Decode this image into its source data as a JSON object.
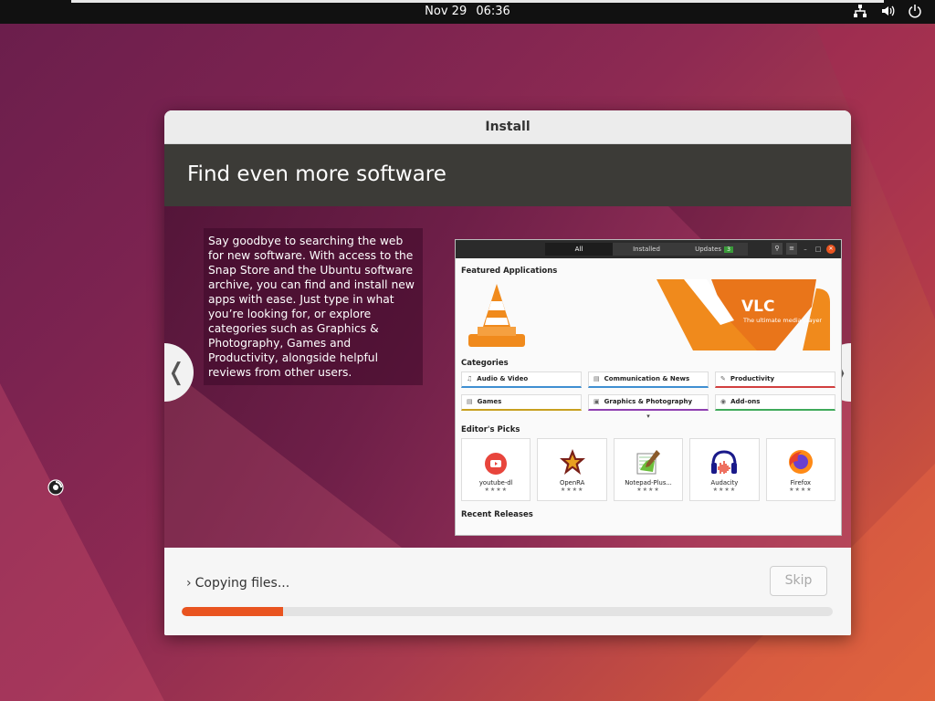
{
  "topbar": {
    "date": "Nov 29",
    "time": "06:36",
    "icons": [
      "network-icon",
      "volume-icon",
      "power-icon"
    ]
  },
  "window": {
    "title": "Install",
    "slide": {
      "heading": "Find even more software",
      "body": "Say goodbye to searching the web for new software. With access to the Snap Store and the Ubuntu software archive, you can find and install new apps with ease. Just type in what you’re looking for, or explore categories such as Graphics & Photography, Games and Productivity, alongside helpful reviews from other users.",
      "prev_icon": "chevron-left-icon",
      "next_icon": "chevron-right-icon",
      "screenshot": {
        "tabs": [
          "All",
          "Installed",
          "Updates"
        ],
        "updates_badge": "3",
        "featured_title": "Featured Applications",
        "featured_app": "VLC",
        "featured_tagline": "The ultimate media player",
        "categories_title": "Categories",
        "categories": [
          "Audio & Video",
          "Communication & News",
          "Productivity",
          "Games",
          "Graphics & Photography",
          "Add-ons"
        ],
        "picks_title": "Editor's Picks",
        "picks": [
          "youtube-dl",
          "OpenRA",
          "Notepad-Plus...",
          "Audacity",
          "Firefox"
        ],
        "stars": "★★★★",
        "recent_title": "Recent Releases"
      }
    },
    "footer": {
      "status": "Copying files...",
      "skip_label": "Skip",
      "progress": 0.155
    }
  },
  "colors": {
    "accent": "#e95420",
    "header_bg": "#3c3b37"
  }
}
